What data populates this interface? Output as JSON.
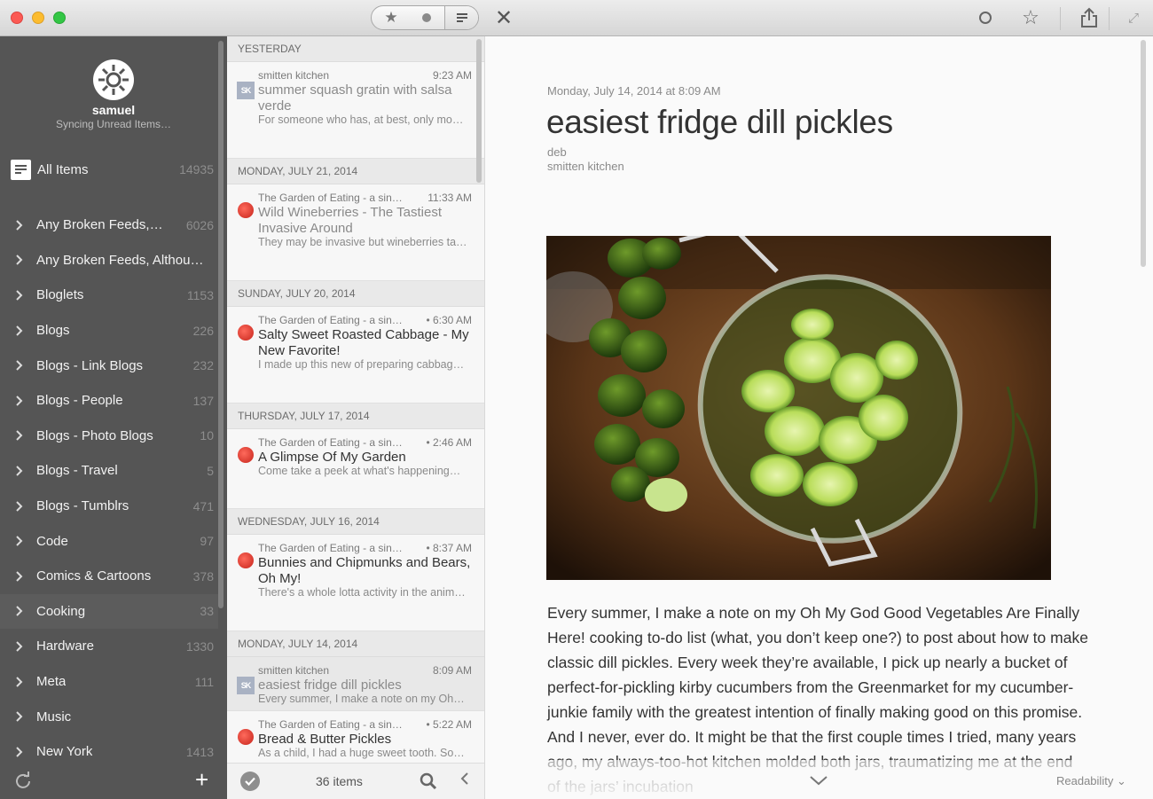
{
  "toolbar": {
    "filter_starred": "★",
    "close_icon": "✕",
    "star_icon": "☆",
    "expand_icon": "⤢"
  },
  "sidebar": {
    "username": "samuel",
    "sync_status": "Syncing Unread Items…",
    "all_items": {
      "label": "All Items",
      "count": "14935"
    },
    "folders": [
      {
        "label": "Any Broken Feeds,…",
        "count": "6026"
      },
      {
        "label": "Any Broken Feeds, Althou…",
        "count": ""
      },
      {
        "label": "Bloglets",
        "count": "1153"
      },
      {
        "label": "Blogs",
        "count": "226"
      },
      {
        "label": "Blogs - Link Blogs",
        "count": "232"
      },
      {
        "label": "Blogs - People",
        "count": "137"
      },
      {
        "label": "Blogs - Photo Blogs",
        "count": "10"
      },
      {
        "label": "Blogs - Travel",
        "count": "5"
      },
      {
        "label": "Blogs - Tumblrs",
        "count": "471"
      },
      {
        "label": "Code",
        "count": "97"
      },
      {
        "label": "Comics & Cartoons",
        "count": "378"
      },
      {
        "label": "Cooking",
        "count": "33"
      },
      {
        "label": "Hardware",
        "count": "1330"
      },
      {
        "label": "Meta",
        "count": "111"
      },
      {
        "label": "Music",
        "count": ""
      },
      {
        "label": "New York",
        "count": "1413"
      }
    ]
  },
  "list": {
    "groups": [
      {
        "header": "YESTERDAY",
        "entries": [
          {
            "source": "smitten kitchen",
            "time": "9:23 AM",
            "title": "summer squash gratin with salsa verde",
            "summary": "For someone who has, at best, only mo…",
            "favicon": "sk",
            "read": true
          }
        ]
      },
      {
        "header": "MONDAY, JULY 21, 2014",
        "entries": [
          {
            "source": "The Garden of Eating - a sin…",
            "time": "11:33 AM",
            "title": "Wild Wineberries - The Tastiest Invasive Around",
            "summary": "They may be invasive but wineberries ta…",
            "favicon": "apple",
            "read": true
          }
        ]
      },
      {
        "header": "SUNDAY, JULY 20, 2014",
        "entries": [
          {
            "source": "The Garden of Eating - a sin…",
            "time": "• 6:30 AM",
            "title": "Salty Sweet Roasted Cabbage - My New Favorite!",
            "summary": "I made up this new of preparing cabbag…",
            "favicon": "apple",
            "read": false
          }
        ]
      },
      {
        "header": "THURSDAY, JULY 17, 2014",
        "entries": [
          {
            "source": "The Garden of Eating - a sin…",
            "time": "• 2:46 AM",
            "title": "A Glimpse Of My Garden",
            "summary": "Come take a peek at what's happening…",
            "favicon": "apple",
            "read": false
          }
        ]
      },
      {
        "header": "WEDNESDAY, JULY 16, 2014",
        "entries": [
          {
            "source": "The Garden of Eating - a sin…",
            "time": "• 8:37 AM",
            "title": "Bunnies and Chipmunks and Bears, Oh My!",
            "summary": "There's a whole lotta activity in the anim…",
            "favicon": "apple",
            "read": false
          }
        ]
      },
      {
        "header": "MONDAY, JULY 14, 2014",
        "entries": [
          {
            "source": "smitten kitchen",
            "time": "8:09 AM",
            "title": "easiest fridge dill pickles",
            "summary": "Every summer, I make a note on my Oh…",
            "favicon": "sk",
            "read": true,
            "selected": true
          },
          {
            "source": "The Garden of Eating - a sin…",
            "time": "• 5:22 AM",
            "title": "Bread & Butter Pickles",
            "summary": "As a child, I had a huge sweet tooth. So…",
            "favicon": "apple",
            "read": false
          }
        ]
      }
    ],
    "footer": {
      "count": "36 items"
    }
  },
  "article": {
    "date": "Monday, July 14, 2014 at 8:09 AM",
    "title": "easiest fridge dill pickles",
    "author": "deb",
    "feed": "smitten kitchen",
    "body": "Every summer, I make a note on my Oh My God Good Vegetables Are Finally Here! cooking to-do list (what, you don’t keep one?) to post about how to make classic dill pickles. Every week they’re available, I pick up nearly a bucket of perfect-for-pickling kirby cucumbers from the Greenmarket for my cucumber-junkie family with the greatest intention of finally making good on this promise. And I never, ever do. It might be that the first couple times I tried, many years ago, my always-too-hot kitchen molded both jars, traumatizing me at the end of the jars’ incubation",
    "readability_label": "Readability"
  },
  "colors": {
    "sidebar_bg": "#555555",
    "list_bg": "#f5f5f5",
    "reader_bg": "#fafafa",
    "unread_favicon": "#d9342b"
  }
}
